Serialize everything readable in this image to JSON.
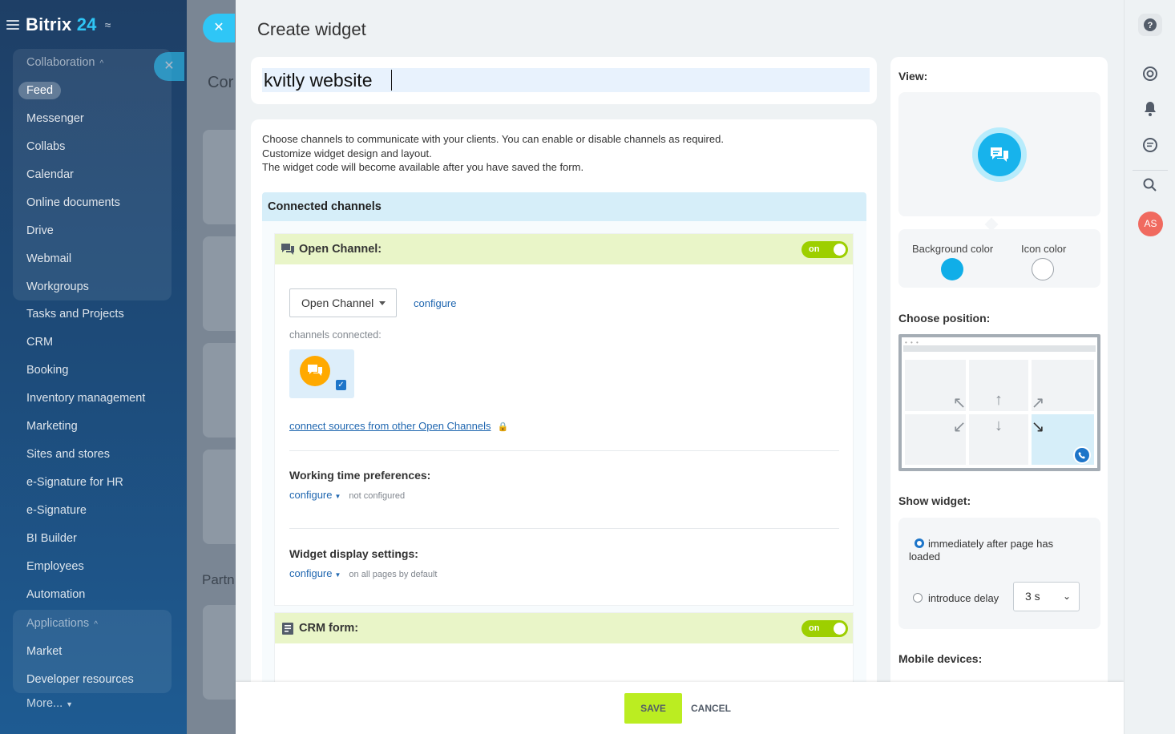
{
  "brand": {
    "name": "Bitrix",
    "number": "24"
  },
  "nav": {
    "collaboration_label": "Collaboration",
    "collaboration_items": [
      "Feed",
      "Messenger",
      "Collabs",
      "Calendar",
      "Online documents",
      "Drive",
      "Webmail",
      "Workgroups"
    ],
    "main_items": [
      "Tasks and Projects",
      "CRM",
      "Booking",
      "Inventory management",
      "Marketing",
      "Sites and stores",
      "e-Signature for HR",
      "e-Signature",
      "BI Builder",
      "Employees",
      "Automation"
    ],
    "applications_label": "Applications",
    "applications_items": [
      "Market",
      "Developer resources"
    ],
    "more_label": "More..."
  },
  "background": {
    "title_fragment": "Cor",
    "section_fragment": "Partn"
  },
  "panel": {
    "title": "Create widget",
    "widget_name": "kvitly website",
    "intro_lines": [
      "Choose channels to communicate with your clients. You can enable or disable channels as required.",
      "Customize widget design and layout.",
      "The widget code will become available after you have saved the form."
    ],
    "connected_channels_label": "Connected channels",
    "open_channel": {
      "label": "Open Channel:",
      "toggle_label": "on",
      "select_value": "Open Channel",
      "configure_label": "configure",
      "channels_connected_label": "channels connected:",
      "connect_sources_label": "connect sources from other Open Channels",
      "working_time_title": "Working time preferences:",
      "working_time_link": "configure",
      "working_time_note": "not configured",
      "display_title": "Widget display settings:",
      "display_link": "configure",
      "display_note": "on all pages by default"
    },
    "crm_form": {
      "label": "CRM form:",
      "toggle_label": "on"
    }
  },
  "right": {
    "view_label": "View:",
    "background_color_label": "Background color",
    "icon_color_label": "Icon color",
    "background_color": "#10aee8",
    "icon_color": "#ffffff",
    "choose_position_label": "Choose position:",
    "selected_position": "bottom-right",
    "show_widget_label": "Show widget:",
    "option_immediately": "immediately after page has loaded",
    "option_delay": "introduce delay",
    "delay_value": "3 s",
    "mobile_label": "Mobile devices:"
  },
  "footer": {
    "save_label": "SAVE",
    "cancel_label": "CANCEL"
  },
  "user": {
    "initials": "AS"
  },
  "colors": {
    "accent": "#2fc6f6",
    "save": "#bbed21",
    "toggle_on": "#9dcf00",
    "link": "#2067b0"
  }
}
